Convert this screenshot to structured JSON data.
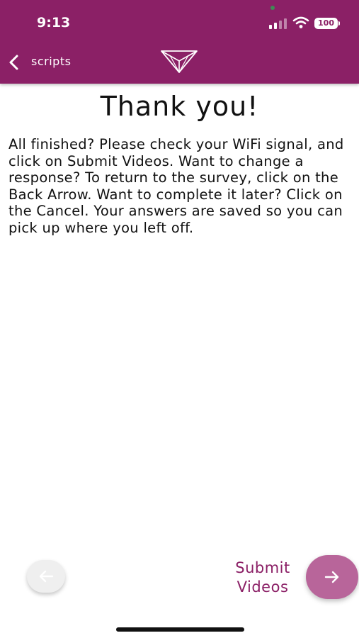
{
  "status_bar": {
    "time": "9:13",
    "battery": "100",
    "icons": [
      "signal-icon",
      "wifi-icon",
      "battery-icon"
    ]
  },
  "nav": {
    "back_label": "scripts",
    "back_icon": "chevron-left-icon",
    "logo_icon": "triangle-logo-icon"
  },
  "content": {
    "title": "Thank you!",
    "message": "All finished? Please check your WiFi signal, and click on Submit Videos. Want to change a response? To return to the survey, click on the Back Arrow. Want to complete it later? Click on the Cancel. Your answers are saved so you can pick up where you left off."
  },
  "footer": {
    "submit_label": "Submit Videos",
    "prev_icon": "arrow-left-icon",
    "next_icon": "arrow-right-icon"
  },
  "colors": {
    "header_bg": "#8b2066",
    "accent_text": "#8b2066",
    "next_button_bg": "#b8659a",
    "prev_button_bg": "#efefef"
  }
}
